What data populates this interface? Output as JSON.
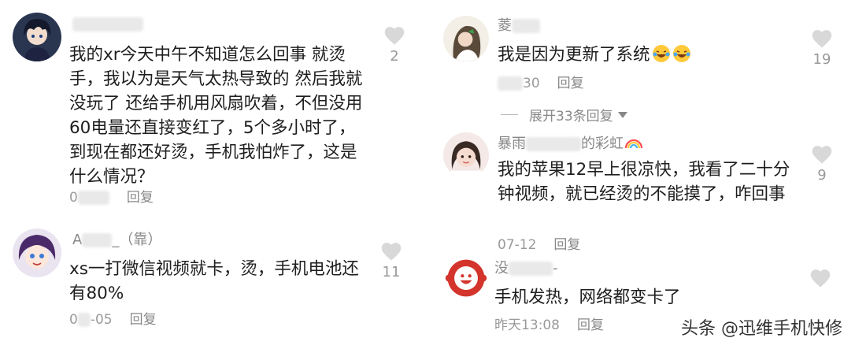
{
  "left_comments": [
    {
      "name_visible": "",
      "body": "我的xr今天中午不知道怎么回事 就烫手，我以为是天气太热导致的 然后我就没玩了 还给手机用风扇吹着，不但没用 60电量还直接变红了，5个多小时了，到现在都还好烫，手机我怕炸了，这是什么情况？",
      "date_visible": "0",
      "reply_label": "回复",
      "likes": "2"
    },
    {
      "name_prefix": "A",
      "name_suffix": "_（靠）",
      "body": "xs一打微信视频就卡，烫，手机电池还有80%",
      "date_prefix": "0",
      "date_suffix": "-05",
      "reply_label": "回复",
      "likes": "11"
    }
  ],
  "right_comments": [
    {
      "name_visible": "菱",
      "body": "我是因为更新了系统",
      "date_visible": "30",
      "reply_label": "回复",
      "likes": "19"
    },
    {
      "name_prefix": "暴雨",
      "name_suffix": "的彩虹",
      "body": "我的苹果12早上很凉快，我看了二十分钟视频，就已经烫的不能摸了，咋回事",
      "date": "07-12",
      "reply_label": "回复",
      "likes": "9"
    },
    {
      "name_prefix": "没",
      "name_suffix": "-",
      "body": "手机发热，网络都变卡了",
      "date": "昨天13:08",
      "reply_label": "回复",
      "likes": ""
    }
  ],
  "expand_label": "展开33条回复",
  "watermark": "头条 @迅维手机快修",
  "colors": {
    "heart": "#d8d8d8",
    "meta": "#9a9a9a",
    "avatar5": "#d3342c"
  }
}
